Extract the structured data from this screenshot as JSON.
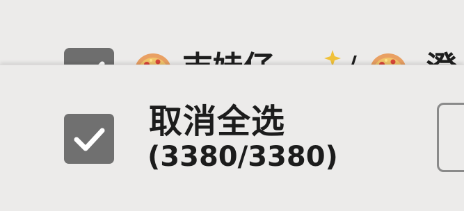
{
  "list": {
    "row": {
      "title_start": "吉娃仔",
      "title_separator": "/",
      "title_end": "澄",
      "selected": true
    }
  },
  "selection_bar": {
    "select_all_label": "取消全选",
    "count_text": "(3380/3380)",
    "selected": true
  },
  "colors": {
    "background": "#ecebea",
    "checkbox_fill": "#707070",
    "text": "#1c1c1c",
    "button_border": "#8a8a8a"
  },
  "icons": {
    "row_checkbox": "checkmark-icon",
    "pizza": "pizza-icon",
    "sparkle": "sparkle-icon",
    "select_all_checkbox": "checkmark-icon"
  }
}
